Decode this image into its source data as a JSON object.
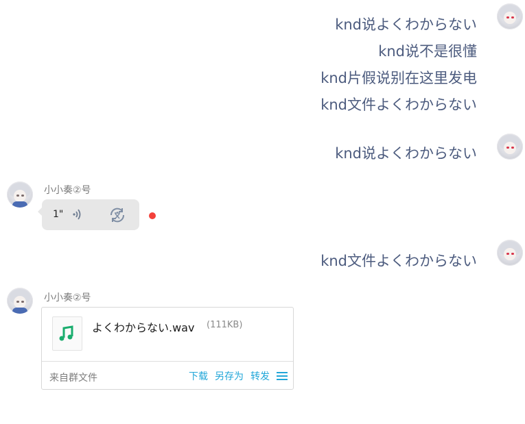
{
  "messages_outgoing_1": [
    "knd说よくわからない",
    "knd说不是很懂",
    "knd片假说别在这里发电",
    "knd文件よくわからない"
  ],
  "messages_outgoing_2": "knd说よくわからない",
  "voice_message": {
    "sender": "小小奏②号",
    "duration": "1\"",
    "wave_icon": "voice-wave-icon",
    "translate_icon": "translate-icon"
  },
  "messages_outgoing_3": "knd文件よくわからない",
  "file_message": {
    "sender": "小小奏②号",
    "file_name": "よくわからない.wav",
    "file_size": "(111KB)",
    "source": "来自群文件",
    "actions": [
      "下载",
      "另存为",
      "转发"
    ],
    "icon": "music-file-icon"
  },
  "colors": {
    "outgoing_text": "#4c5b7e",
    "accent": "#20a6d8",
    "unread": "#f3413a",
    "file_icon": "#1aad6e"
  }
}
